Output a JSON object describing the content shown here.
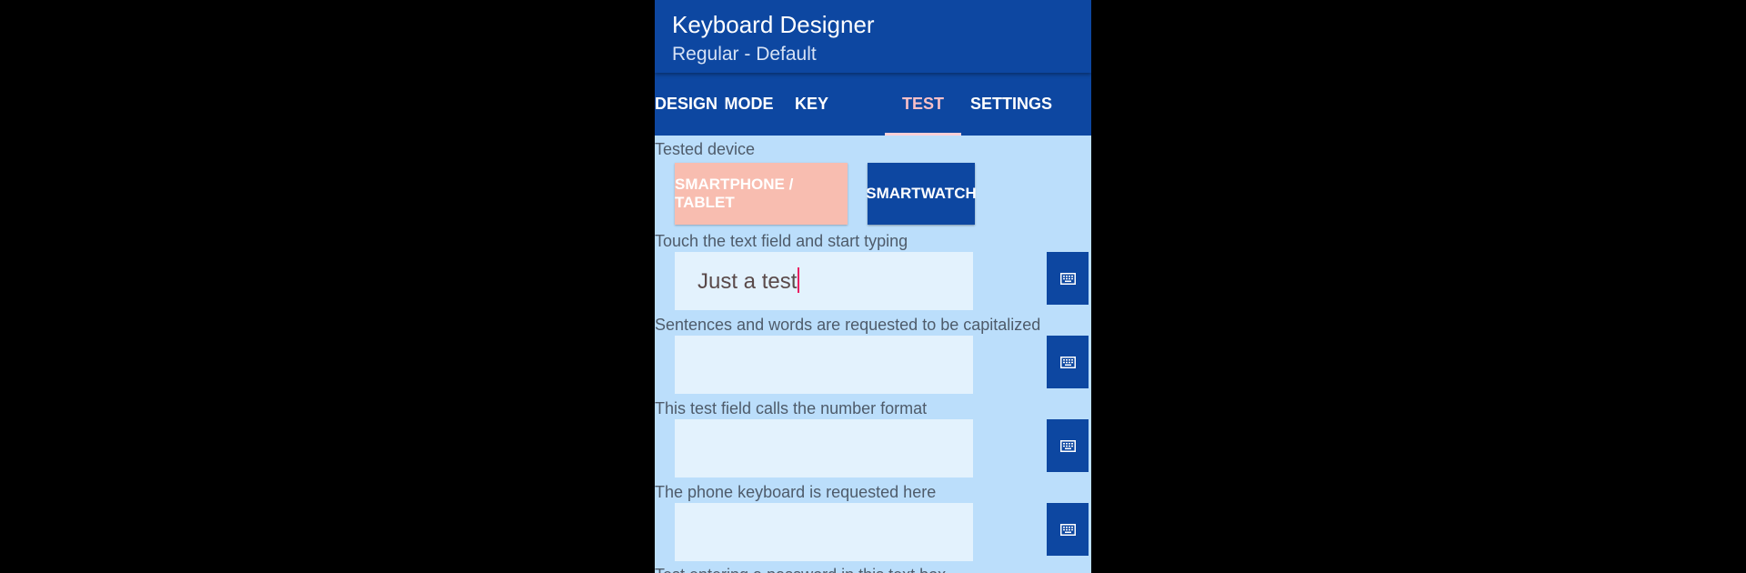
{
  "app": {
    "title": "Keyboard Designer",
    "subtitle": "Regular - Default"
  },
  "tabs": [
    {
      "label": "DESIGN",
      "active": false
    },
    {
      "label": "MODE",
      "active": false
    },
    {
      "label": "KEY",
      "active": false
    },
    {
      "label": "TEST",
      "active": true
    },
    {
      "label": "SETTINGS",
      "active": false
    }
  ],
  "test": {
    "device_label": "Tested device",
    "device_buttons": {
      "phone": "SMARTPHONE / TABLET",
      "watch": "SMARTWATCH"
    },
    "fields": [
      {
        "label": "Touch the text field and start typing",
        "value": "Just a test"
      },
      {
        "label": "Sentences and words are requested to be capitalized",
        "value": ""
      },
      {
        "label": "This test field calls the number format",
        "value": ""
      },
      {
        "label": "The phone keyboard is requested here",
        "value": ""
      }
    ],
    "cut_off_label": "Test entering a password in this text box"
  },
  "icons": {
    "keyboard_button": "keyboard-icon"
  },
  "colors": {
    "primary": "#0d47a1",
    "background": "#bbdefb",
    "field": "#e3f2fd",
    "accent_button": "#f8bdb0",
    "active_tab_text": "#f8c0c7",
    "caret": "#e91e63"
  }
}
